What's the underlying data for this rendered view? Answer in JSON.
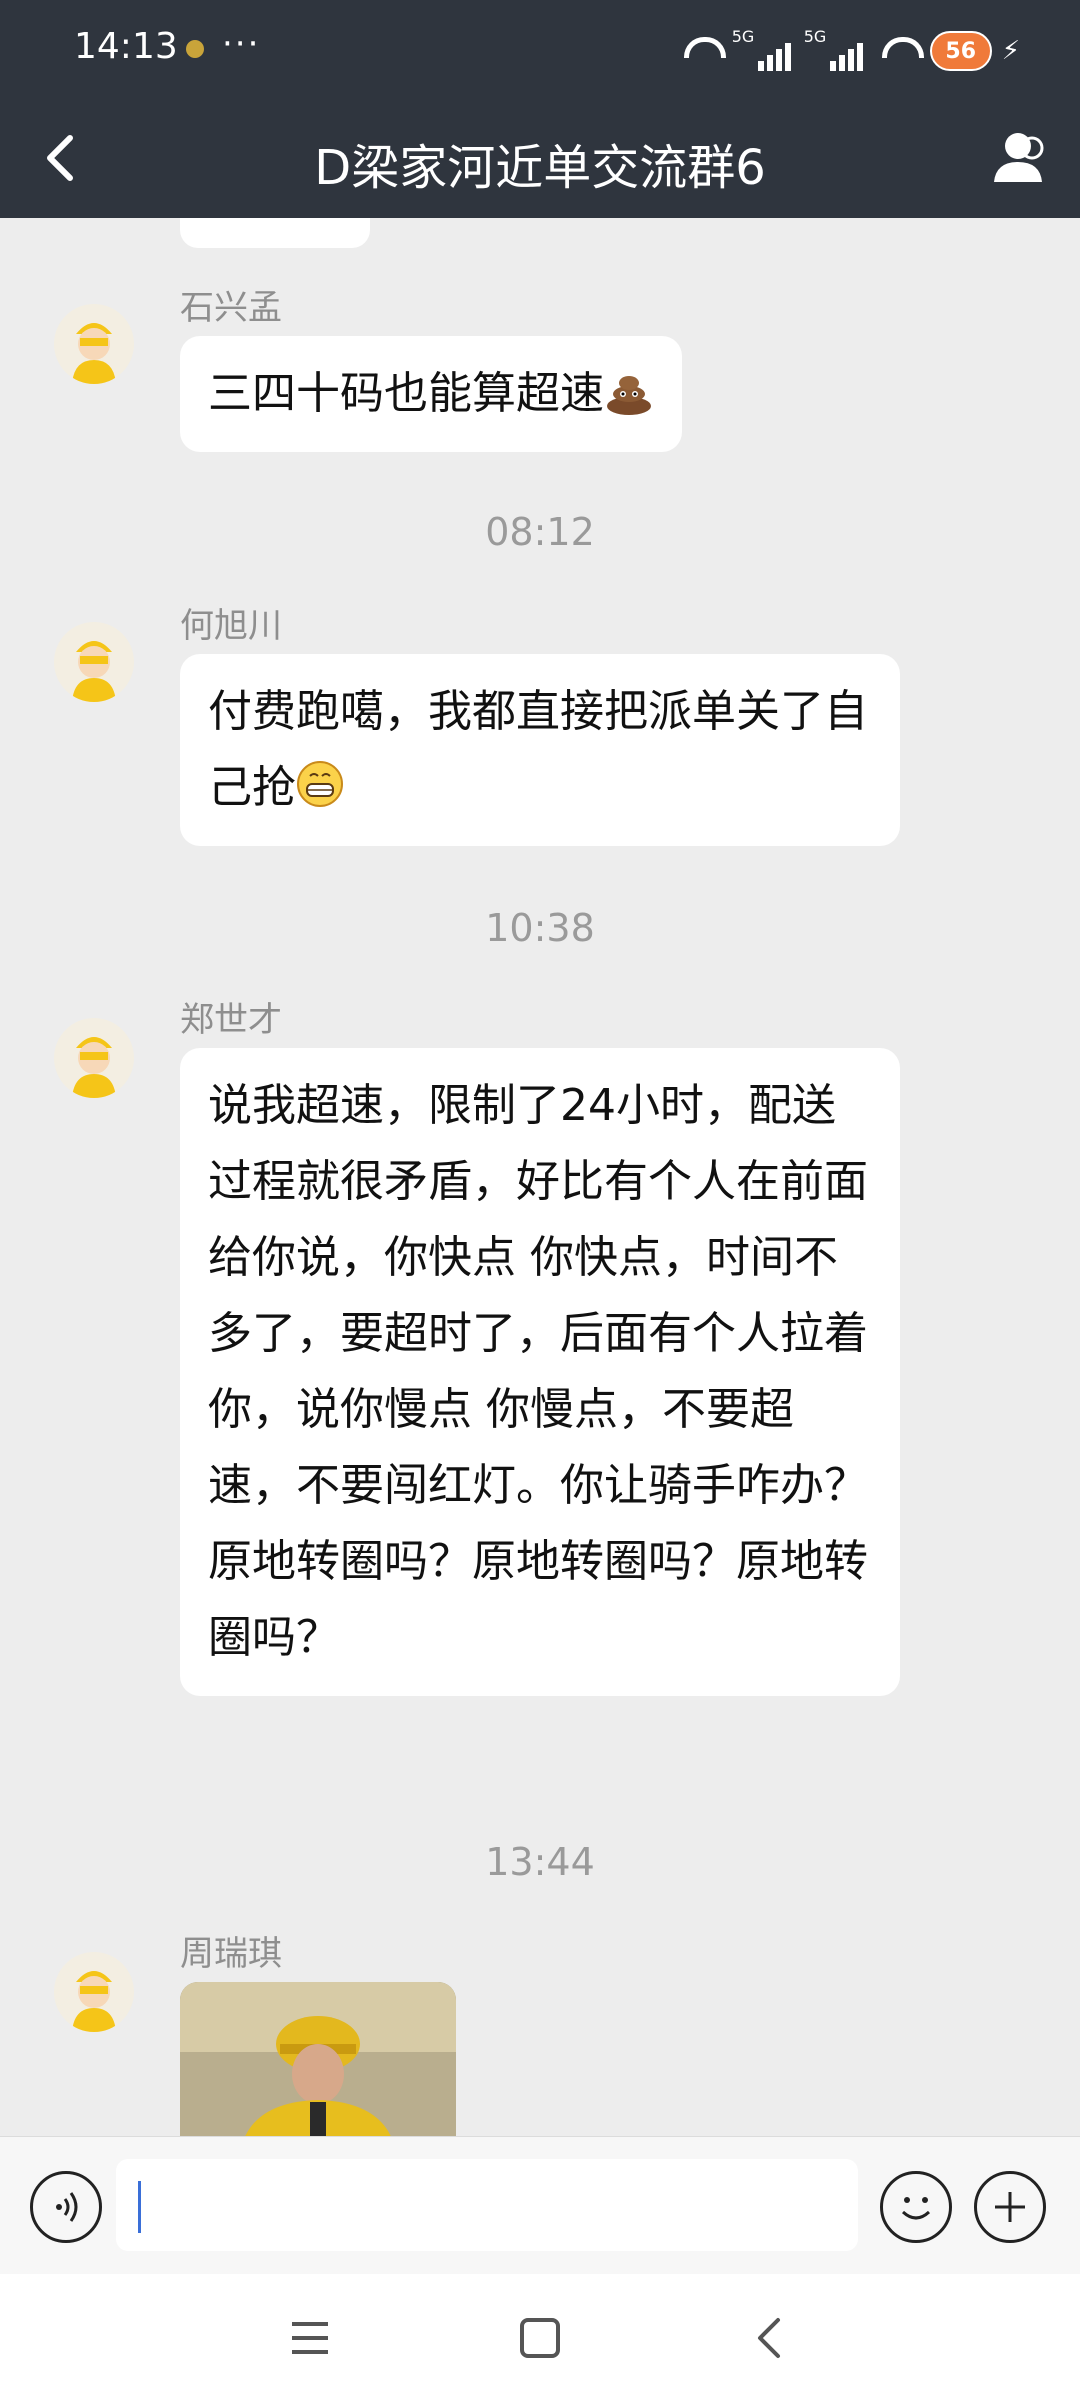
{
  "status_bar": {
    "time": "14:13",
    "more": "···",
    "network_badge": "5G",
    "battery_level": "56"
  },
  "nav": {
    "title": "D梁家河近单交流群6",
    "back_icon": "chevron-left-icon",
    "members_icon": "person-icon"
  },
  "timestamps": [
    "08:12",
    "10:38",
    "13:44"
  ],
  "messages": [
    {
      "sender": "石兴孟",
      "text": "三四十码也能算超速",
      "emoji": "poop-emoji"
    },
    {
      "sender": "何旭川",
      "text": "付费跑噶，我都直接把派单关了自己抢",
      "emoji": "grin-emoji"
    },
    {
      "sender": "郑世才",
      "text": "说我超速，限制了24小时，配送过程就很矛盾，好比有个人在前面给你说，你快点  你快点，时间不多了，要超时了，后面有个人拉着你，说你慢点  你慢点，不要超速，不要闯红灯。你让骑手咋办？原地转圈吗？原地转圈吗？原地转圈吗？"
    },
    {
      "sender": "周瑞琪",
      "type": "image"
    }
  ],
  "input_bar": {
    "placeholder": "",
    "value": ""
  },
  "colors": {
    "header_bg": "#2F353E",
    "chat_bg": "#EDEDED",
    "bubble_bg": "#FFFFFF"
  }
}
